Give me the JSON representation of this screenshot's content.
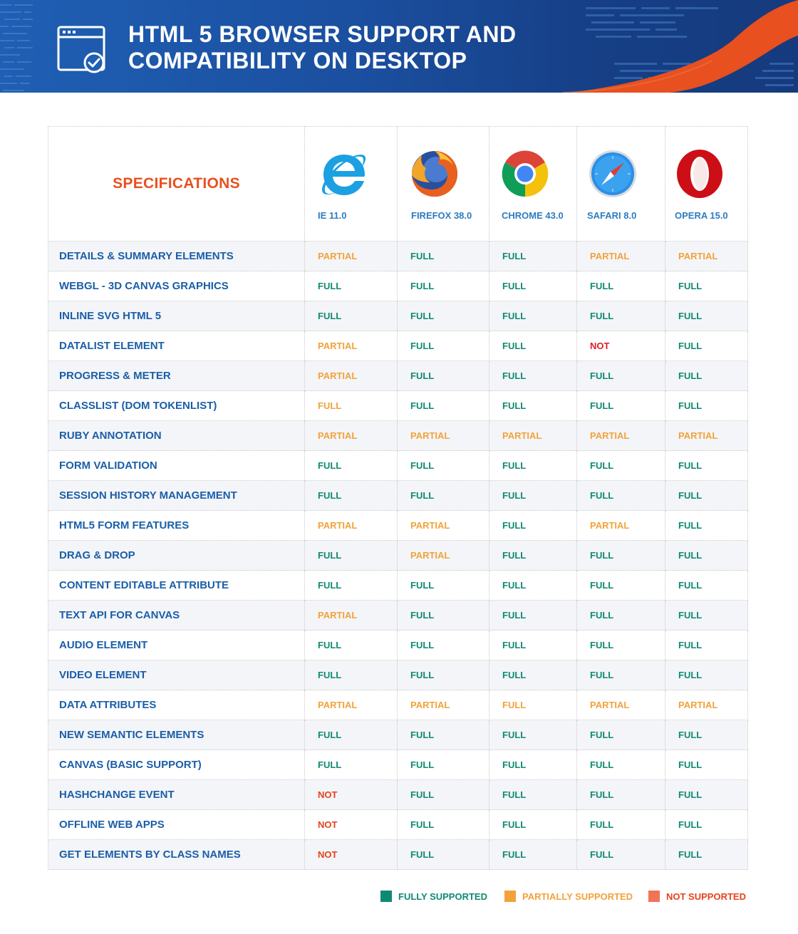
{
  "header": {
    "title_line1": "HTML 5 BROWSER SUPPORT AND",
    "title_line2": "COMPATIBILITY ON DESKTOP",
    "icon": "browser-window-check-icon"
  },
  "colors": {
    "banner_blue": "#1f5fb4",
    "accent_orange": "#e8501f",
    "full": "#0f8a72",
    "partial": "#f2a23a",
    "not": "#e5431f"
  },
  "table": {
    "spec_header": "SPECIFICATIONS",
    "browsers": [
      {
        "name": "IE 11.0",
        "icon": "internet-explorer-icon"
      },
      {
        "name": "FIREFOX 38.0",
        "icon": "firefox-icon"
      },
      {
        "name": "CHROME 43.0",
        "icon": "chrome-icon"
      },
      {
        "name": "SAFARI 8.0",
        "icon": "safari-icon"
      },
      {
        "name": "OPERA 15.0",
        "icon": "opera-icon"
      }
    ],
    "rows": [
      {
        "feature": "DETAILS & SUMMARY ELEMENTS",
        "values": [
          "PARTIAL",
          "FULL",
          "FULL",
          "PARTIAL",
          "PARTIAL"
        ]
      },
      {
        "feature": "WEBGL - 3D CANVAS GRAPHICS",
        "values": [
          "FULL",
          "FULL",
          "FULL",
          "FULL",
          "FULL"
        ]
      },
      {
        "feature": "INLINE SVG HTML 5",
        "values": [
          "FULL",
          "FULL",
          "FULL",
          "FULL",
          "FULL"
        ]
      },
      {
        "feature": "DATALIST ELEMENT",
        "values": [
          "PARTIAL",
          "FULL",
          "FULL",
          "NOT",
          "FULL"
        ]
      },
      {
        "feature": "PROGRESS & METER",
        "values": [
          "PARTIAL",
          "FULL",
          "FULL",
          "FULL",
          "FULL"
        ]
      },
      {
        "feature": "CLASSLIST (DOM TOKENLIST)",
        "values": [
          "FULL",
          "FULL",
          "FULL",
          "FULL",
          "FULL"
        ]
      },
      {
        "feature": "RUBY ANNOTATION",
        "values": [
          "PARTIAL",
          "PARTIAL",
          "PARTIAL",
          "PARTIAL",
          "PARTIAL"
        ]
      },
      {
        "feature": "FORM VALIDATION",
        "values": [
          "FULL",
          "FULL",
          "FULL",
          "FULL",
          "FULL"
        ]
      },
      {
        "feature": "SESSION HISTORY MANAGEMENT",
        "values": [
          "FULL",
          "FULL",
          "FULL",
          "FULL",
          "FULL"
        ]
      },
      {
        "feature": "HTML5 FORM FEATURES",
        "values": [
          "PARTIAL",
          "PARTIAL",
          "FULL",
          "PARTIAL",
          "FULL"
        ]
      },
      {
        "feature": "DRAG & DROP",
        "values": [
          "FULL",
          "PARTIAL",
          "FULL",
          "FULL",
          "FULL"
        ]
      },
      {
        "feature": "CONTENT EDITABLE ATTRIBUTE",
        "values": [
          "FULL",
          "FULL",
          "FULL",
          "FULL",
          "FULL"
        ]
      },
      {
        "feature": "TEXT API FOR CANVAS",
        "values": [
          "PARTIAL",
          "FULL",
          "FULL",
          "FULL",
          "FULL"
        ]
      },
      {
        "feature": "AUDIO ELEMENT",
        "values": [
          "FULL",
          "FULL",
          "FULL",
          "FULL",
          "FULL"
        ]
      },
      {
        "feature": "VIDEO ELEMENT",
        "values": [
          "FULL",
          "FULL",
          "FULL",
          "FULL",
          "FULL"
        ]
      },
      {
        "feature": "DATA ATTRIBUTES",
        "values": [
          "PARTIAL",
          "PARTIAL",
          "FULL",
          "PARTIAL",
          "PARTIAL"
        ]
      },
      {
        "feature": "NEW SEMANTIC ELEMENTS",
        "values": [
          "FULL",
          "FULL",
          "FULL",
          "FULL",
          "FULL"
        ]
      },
      {
        "feature": "CANVAS (BASIC SUPPORT)",
        "values": [
          "FULL",
          "FULL",
          "FULL",
          "FULL",
          "FULL"
        ]
      },
      {
        "feature": "HASHCHANGE EVENT",
        "values": [
          "NOT",
          "FULL",
          "FULL",
          "FULL",
          "FULL"
        ]
      },
      {
        "feature": "OFFLINE WEB APPS",
        "values": [
          "NOT",
          "FULL",
          "FULL",
          "FULL",
          "FULL"
        ]
      },
      {
        "feature": "GET ELEMENTS BY CLASS NAMES",
        "values": [
          "NOT",
          "FULL",
          "FULL",
          "FULL",
          "FULL"
        ]
      }
    ]
  },
  "legend": {
    "full": "FULLY SUPPORTED",
    "partial": "PARTIALLY SUPPORTED",
    "not": "NOT SUPPORTED"
  }
}
